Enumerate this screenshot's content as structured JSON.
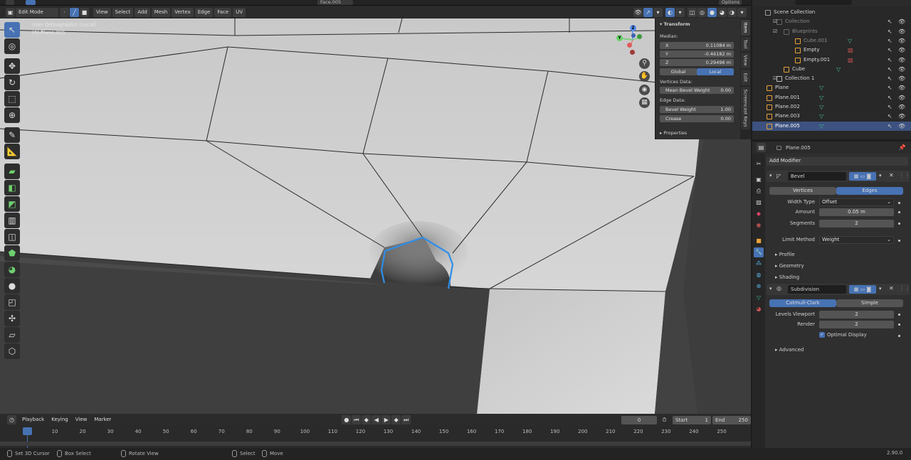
{
  "topbar": {
    "face_label": "Face.005",
    "options_label": "Options"
  },
  "viewport_header": {
    "mode": "Edit Mode",
    "menus": [
      "View",
      "Select",
      "Add",
      "Mesh",
      "Vertex",
      "Edge",
      "Face",
      "UV"
    ]
  },
  "viewport": {
    "view_name": "User Orthographic (Local)",
    "object_name": "(0) Plane.005",
    "gizmo": {
      "z": "Z",
      "y": "Y"
    }
  },
  "npanel": {
    "tabs": [
      "Item",
      "Tool",
      "View",
      "Edit",
      "Screencast Keys"
    ],
    "transform_title": "Transform",
    "median_label": "Median:",
    "x_label": "X",
    "x_value": "0.11084 m",
    "y_label": "Y",
    "y_value": "-0.46182 m",
    "z_label": "Z",
    "z_value": "0.29496 m",
    "space_global": "Global",
    "space_local": "Local",
    "vertices_data_label": "Vertices Data:",
    "mean_bevel_weight_label": "Mean Bevel Weight",
    "mean_bevel_weight_value": "0.00",
    "edge_data_label": "Edge Data:",
    "bevel_weight_label": "Bevel Weight",
    "bevel_weight_value": "1.00",
    "crease_label": "Crease",
    "crease_value": "0.00",
    "properties_title": "Properties"
  },
  "outliner": {
    "items": [
      {
        "name": "Scene Collection",
        "type": "scene"
      },
      {
        "name": "Collection",
        "type": "collection",
        "dim": true
      },
      {
        "name": "Blueprints",
        "type": "collection",
        "dim": true
      },
      {
        "name": "Cube.001",
        "type": "mesh",
        "dim": true
      },
      {
        "name": "Empty",
        "type": "empty"
      },
      {
        "name": "Empty.001",
        "type": "empty"
      },
      {
        "name": "Cube",
        "type": "mesh"
      },
      {
        "name": "Collection 1",
        "type": "collection"
      },
      {
        "name": "Plane",
        "type": "mesh"
      },
      {
        "name": "Plane.001",
        "type": "mesh"
      },
      {
        "name": "Plane.002",
        "type": "mesh"
      },
      {
        "name": "Plane.003",
        "type": "mesh"
      },
      {
        "name": "Plane.005",
        "type": "mesh",
        "selected": true
      }
    ]
  },
  "properties": {
    "object_name": "Plane.005",
    "add_modifier": "Add Modifier",
    "bevel": {
      "name": "Bevel",
      "tab_vertices": "Vertices",
      "tab_edges": "Edges",
      "width_type_label": "Width Type",
      "width_type_value": "Offset",
      "amount_label": "Amount",
      "amount_value": "0.05 m",
      "segments_label": "Segments",
      "segments_value": "2",
      "limit_method_label": "Limit Method",
      "limit_method_value": "Weight",
      "profile": "Profile",
      "geometry": "Geometry",
      "shading": "Shading"
    },
    "subdivision": {
      "name": "Subdivision",
      "tab_catmull": "Catmull-Clark",
      "tab_simple": "Simple",
      "levels_viewport_label": "Levels Viewport",
      "levels_viewport_value": "2",
      "render_label": "Render",
      "render_value": "2",
      "optimal_display": "Optimal Display",
      "advanced": "Advanced"
    }
  },
  "timeline": {
    "menus": [
      "Playback",
      "Keying",
      "View",
      "Marker"
    ],
    "current_frame": "0",
    "start_label": "Start",
    "start_value": "1",
    "end_label": "End",
    "end_value": "250",
    "ticks": [
      "0",
      "10",
      "20",
      "30",
      "40",
      "50",
      "60",
      "70",
      "80",
      "90",
      "100",
      "110",
      "120",
      "130",
      "140",
      "150",
      "160",
      "170",
      "180",
      "190",
      "200",
      "210",
      "220",
      "230",
      "240",
      "250"
    ]
  },
  "statusbar": {
    "set_cursor": "Set 3D Cursor",
    "box_select": "Box Select",
    "rotate_view": "Rotate View",
    "select": "Select",
    "move": "Move",
    "version": "2.90.0"
  },
  "colors": {
    "accent_blue": "#4772b3",
    "edge_highlight": "#2f8ee8",
    "object_orange": "#e8a23a",
    "mesh_green": "#45c08c"
  }
}
